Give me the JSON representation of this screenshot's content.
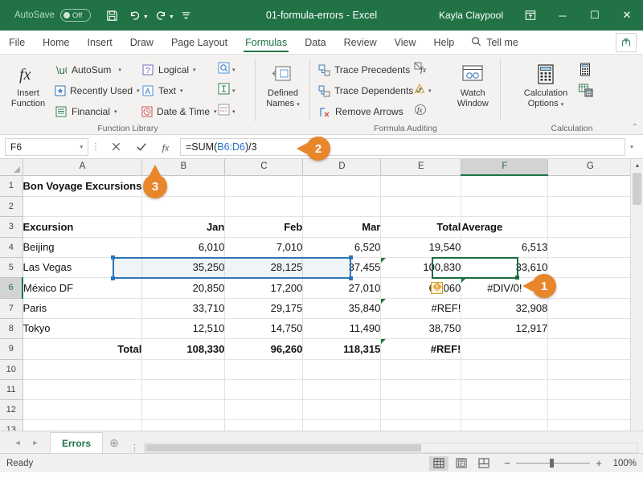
{
  "titlebar": {
    "autosave_label": "AutoSave",
    "autosave_state": "Off",
    "save_icon": "save-icon",
    "undo_icon": "undo-icon",
    "redo_icon": "redo-icon",
    "customize_icon": "customize-qat-icon",
    "document_title": "01-formula-errors  -  Excel",
    "user_name": "Kayla Claypool",
    "ribbon_display_icon": "ribbon-display-options-icon",
    "minimize_label": "─",
    "maximize_label": "☐",
    "close_label": "✕"
  },
  "ribbon": {
    "tabs": [
      {
        "label": "File",
        "active": false
      },
      {
        "label": "Home",
        "active": false
      },
      {
        "label": "Insert",
        "active": false
      },
      {
        "label": "Draw",
        "active": false
      },
      {
        "label": "Page Layout",
        "active": false
      },
      {
        "label": "Formulas",
        "active": true
      },
      {
        "label": "Data",
        "active": false
      },
      {
        "label": "Review",
        "active": false
      },
      {
        "label": "View",
        "active": false
      },
      {
        "label": "Help",
        "active": false
      }
    ],
    "tell_me": "Tell me",
    "share_icon": "share-icon",
    "groups": [
      {
        "name": "Function Library",
        "label": "Function Library",
        "big_button": {
          "line1": "Insert",
          "line2": "Function",
          "icon": "fx-icon"
        },
        "items": [
          {
            "label": "AutoSum",
            "icon": "autosum-icon",
            "caret": true
          },
          {
            "label": "Recently Used",
            "icon": "recently-used-icon",
            "caret": true
          },
          {
            "label": "Financial",
            "icon": "financial-icon",
            "caret": true
          },
          {
            "label": "Logical",
            "icon": "logical-icon",
            "caret": true
          },
          {
            "label": "Text",
            "icon": "text-icon",
            "caret": true
          },
          {
            "label": "Date & Time",
            "icon": "date-time-icon",
            "caret": true
          }
        ],
        "icon_only": [
          "lookup-reference-icon",
          "math-trig-icon",
          "more-functions-icon"
        ]
      },
      {
        "name": "Defined Names",
        "label": "",
        "big_button": {
          "line1": "Defined",
          "line2": "Names",
          "icon": "defined-names-icon",
          "caret": true
        }
      },
      {
        "name": "Formula Auditing",
        "label": "Formula Auditing",
        "items": [
          {
            "label": "Trace Precedents",
            "icon": "trace-precedents-icon"
          },
          {
            "label": "Trace Dependents",
            "icon": "trace-dependents-icon"
          },
          {
            "label": "Remove Arrows",
            "icon": "remove-arrows-icon",
            "caret": true
          }
        ],
        "icon_only": [
          "show-formulas-icon",
          "error-checking-icon",
          "evaluate-formula-icon"
        ],
        "big_button": {
          "line1": "Watch",
          "line2": "Window",
          "icon": "watch-window-icon"
        }
      },
      {
        "name": "Calculation",
        "label": "Calculation",
        "big_button": {
          "line1": "Calculation",
          "line2": "Options",
          "icon": "calculation-options-icon",
          "caret": true
        },
        "icon_only": [
          "calculate-now-icon",
          "calculate-sheet-icon"
        ]
      }
    ],
    "dialog_launcher": "⌃"
  },
  "formula_bar": {
    "name_box_value": "F6",
    "name_box_caret": "▾",
    "cancel_icon": "cancel-icon",
    "enter_icon": "enter-checkmark-icon",
    "insert_function_icon": "insert-function-icon",
    "formula_prefix": "=SUM(",
    "formula_ref": "B6:D6",
    "formula_suffix": ")/3",
    "expand_caret": "▾"
  },
  "grid": {
    "columns": [
      "A",
      "B",
      "C",
      "D",
      "E",
      "F",
      "G"
    ],
    "selected_column": "F",
    "selected_row": "6",
    "rows": [
      {
        "n": "1",
        "cells": [
          {
            "v": "Bon Voyage Excursions",
            "style": "title"
          },
          {
            "v": ""
          },
          {
            "v": ""
          },
          {
            "v": ""
          },
          {
            "v": ""
          },
          {
            "v": ""
          },
          {
            "v": ""
          }
        ]
      },
      {
        "n": "2",
        "cells": [
          {
            "v": ""
          },
          {
            "v": ""
          },
          {
            "v": ""
          },
          {
            "v": ""
          },
          {
            "v": ""
          },
          {
            "v": ""
          },
          {
            "v": ""
          }
        ]
      },
      {
        "n": "3",
        "cells": [
          {
            "v": "Excursion",
            "style": "hdr-bold"
          },
          {
            "v": "Jan",
            "style": "hdr-bold num"
          },
          {
            "v": "Feb",
            "style": "hdr-bold num"
          },
          {
            "v": "Mar",
            "style": "hdr-bold num"
          },
          {
            "v": "Total",
            "style": "hdr-bold num"
          },
          {
            "v": "Average",
            "style": "hdr-bold"
          },
          {
            "v": ""
          }
        ]
      },
      {
        "n": "4",
        "cells": [
          {
            "v": "Beijing"
          },
          {
            "v": "6,010",
            "style": "num"
          },
          {
            "v": "7,010",
            "style": "num"
          },
          {
            "v": "6,520",
            "style": "num"
          },
          {
            "v": "19,540",
            "style": "num"
          },
          {
            "v": "6,513",
            "style": "num"
          },
          {
            "v": ""
          }
        ]
      },
      {
        "n": "5",
        "cells": [
          {
            "v": "Las Vegas"
          },
          {
            "v": "35,250",
            "style": "num"
          },
          {
            "v": "28,125",
            "style": "num"
          },
          {
            "v": "37,455",
            "style": "num"
          },
          {
            "v": "100,830",
            "style": "num",
            "triangle": true
          },
          {
            "v": "33,610",
            "style": "num"
          },
          {
            "v": ""
          }
        ]
      },
      {
        "n": "6",
        "cells": [
          {
            "v": "México DF"
          },
          {
            "v": "20,850",
            "style": "num"
          },
          {
            "v": "17,200",
            "style": "num"
          },
          {
            "v": "27,010",
            "style": "num"
          },
          {
            "v": "65,060",
            "style": "num",
            "error_icon": true
          },
          {
            "v": "#DIV/0!",
            "style": "ctr",
            "triangle": true
          },
          {
            "v": ""
          }
        ]
      },
      {
        "n": "7",
        "cells": [
          {
            "v": "Paris"
          },
          {
            "v": "33,710",
            "style": "num"
          },
          {
            "v": "29,175",
            "style": "num"
          },
          {
            "v": "35,840",
            "style": "num"
          },
          {
            "v": "#REF!",
            "style": "num",
            "triangle": true
          },
          {
            "v": "32,908",
            "style": "num"
          },
          {
            "v": ""
          }
        ]
      },
      {
        "n": "8",
        "cells": [
          {
            "v": "Tokyo"
          },
          {
            "v": "12,510",
            "style": "num"
          },
          {
            "v": "14,750",
            "style": "num"
          },
          {
            "v": "11,490",
            "style": "num"
          },
          {
            "v": "38,750",
            "style": "num"
          },
          {
            "v": "12,917",
            "style": "num"
          },
          {
            "v": ""
          }
        ]
      },
      {
        "n": "9",
        "cells": [
          {
            "v": "Total",
            "style": "num bold"
          },
          {
            "v": "108,330",
            "style": "num bold"
          },
          {
            "v": "96,260",
            "style": "num bold"
          },
          {
            "v": "118,315",
            "style": "num bold"
          },
          {
            "v": "#REF!",
            "style": "num bold",
            "triangle": true
          },
          {
            "v": ""
          },
          {
            "v": ""
          }
        ]
      },
      {
        "n": "10",
        "cells": [
          {
            "v": ""
          },
          {
            "v": ""
          },
          {
            "v": ""
          },
          {
            "v": ""
          },
          {
            "v": ""
          },
          {
            "v": ""
          },
          {
            "v": ""
          }
        ]
      },
      {
        "n": "11",
        "cells": [
          {
            "v": ""
          },
          {
            "v": ""
          },
          {
            "v": ""
          },
          {
            "v": ""
          },
          {
            "v": ""
          },
          {
            "v": ""
          },
          {
            "v": ""
          }
        ]
      },
      {
        "n": "12",
        "cells": [
          {
            "v": ""
          },
          {
            "v": ""
          },
          {
            "v": ""
          },
          {
            "v": ""
          },
          {
            "v": ""
          },
          {
            "v": ""
          },
          {
            "v": ""
          }
        ]
      },
      {
        "n": "13",
        "cells": [
          {
            "v": ""
          },
          {
            "v": ""
          },
          {
            "v": ""
          },
          {
            "v": ""
          },
          {
            "v": ""
          },
          {
            "v": ""
          },
          {
            "v": ""
          }
        ]
      }
    ]
  },
  "sheet_tabs": {
    "prev_arrow": "◄",
    "next_arrow": "►",
    "tabs": [
      {
        "label": "Errors",
        "active": true
      }
    ],
    "add_label": "⊕",
    "overflow_dots": "⋮"
  },
  "statusbar": {
    "status_text": "Ready",
    "views": [
      {
        "name": "normal-view-icon",
        "active": true
      },
      {
        "name": "page-layout-view-icon",
        "active": false
      },
      {
        "name": "page-break-view-icon",
        "active": false
      }
    ],
    "zoom_out": "−",
    "zoom_in": "+",
    "zoom_level": "100%"
  },
  "callouts": [
    {
      "id": "1",
      "number": "1",
      "points_to": "cell-F6"
    },
    {
      "id": "2",
      "number": "2",
      "points_to": "formula-bar-input"
    },
    {
      "id": "3",
      "number": "3",
      "points_to": "formula-enter-button"
    }
  ],
  "colors": {
    "excel_green": "#217346",
    "callout_orange": "#e8862c",
    "ref_blue": "#2a72c8",
    "selection_blue": "#2e75b6",
    "active_cell_green": "#1e6b41"
  }
}
